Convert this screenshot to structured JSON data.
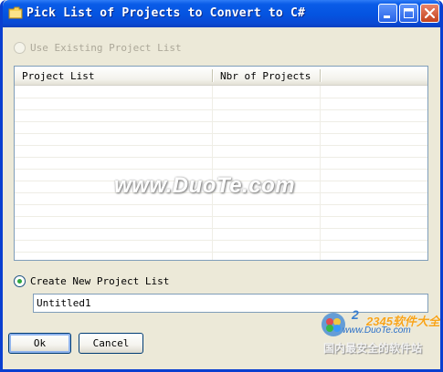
{
  "window": {
    "title": "Pick List of Projects to Convert to C#",
    "icon": "folder-icon",
    "controls": [
      "minimize-icon",
      "maximize-icon",
      "close-icon"
    ]
  },
  "options": {
    "use_existing_label": "Use Existing Project List",
    "use_existing_enabled": false,
    "use_existing_selected": false,
    "create_new_label": "Create New Project List",
    "create_new_selected": true
  },
  "list": {
    "columns": [
      "Project List",
      "Nbr of Projects"
    ],
    "rows": []
  },
  "new_list_name": {
    "value": "Untitled1"
  },
  "buttons": {
    "ok": "Ok",
    "cancel": "Cancel"
  },
  "watermark": {
    "text": "www.DuoTe.com",
    "corner_brand": "2345软件大全",
    "corner_url": "www.DuoTe.com",
    "corner_caption": "国内最安全的软件站"
  },
  "colors": {
    "titlebar": "#0453e0",
    "window_bg": "#ece9d8",
    "radio_selected": "#2fa73f"
  }
}
